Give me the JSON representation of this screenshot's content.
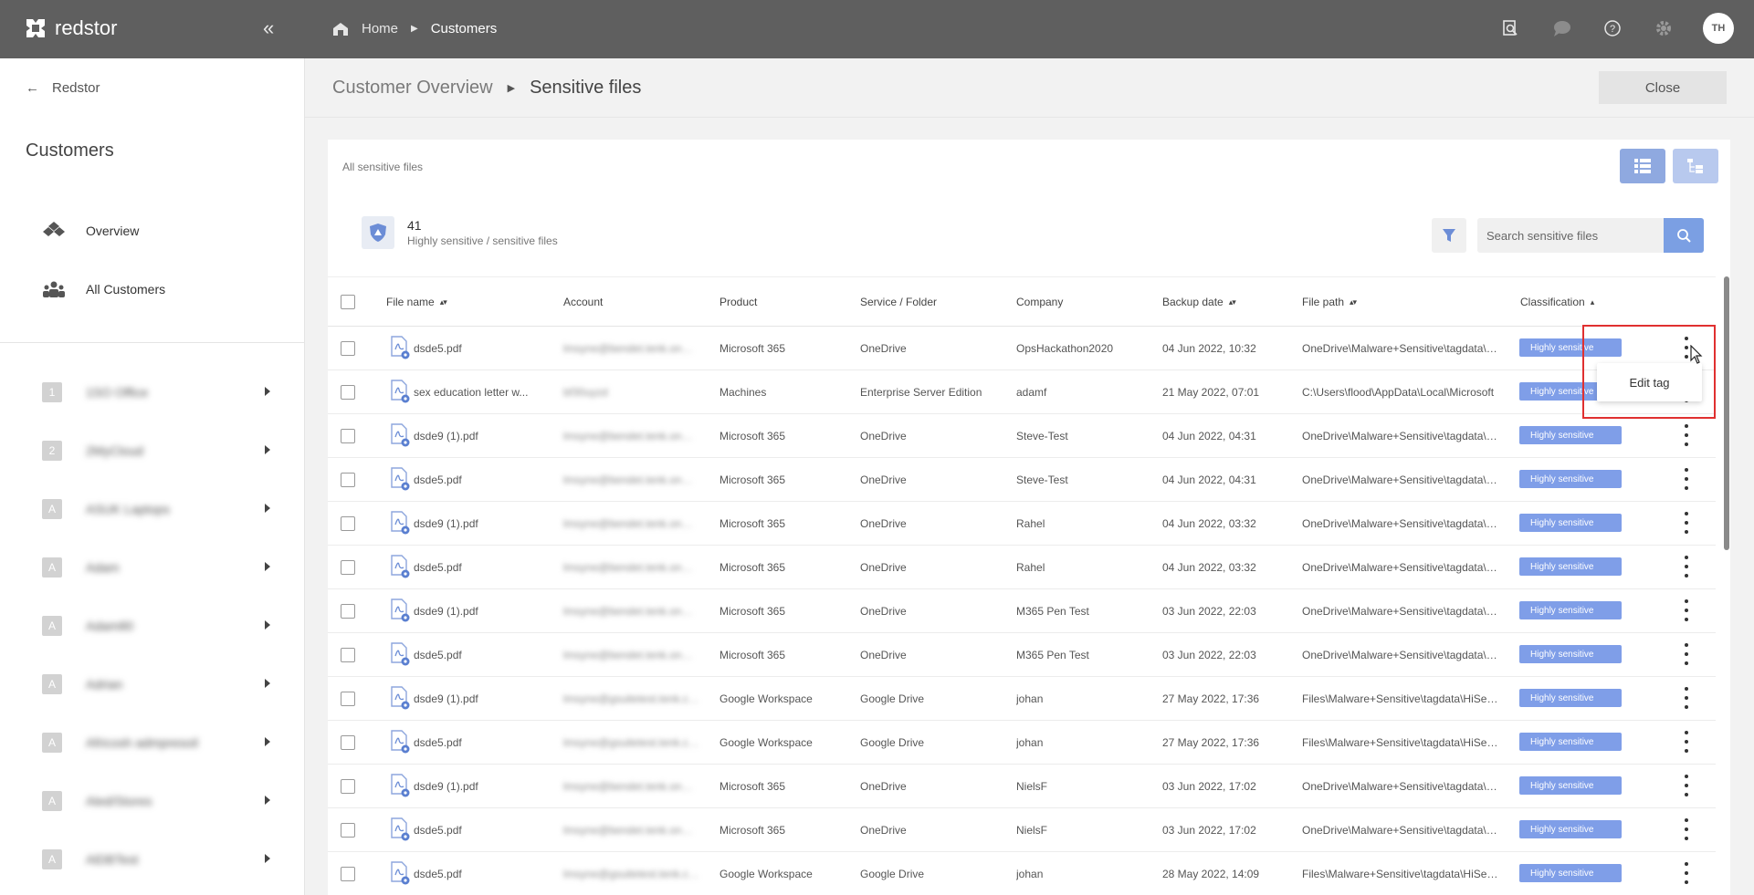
{
  "app": {
    "brand": "redstor",
    "user_initials": "TH"
  },
  "topnav": {
    "breadcrumbs": [
      "Home",
      "Customers"
    ],
    "icons": [
      "search-file-icon",
      "chat-icon",
      "help-icon",
      "gear-icon"
    ]
  },
  "sidebar": {
    "back_label": "Redstor",
    "title": "Customers",
    "nav": [
      {
        "label": "Overview",
        "icon": "overview-icon"
      },
      {
        "label": "All Customers",
        "icon": "people-icon"
      }
    ],
    "customers": [
      {
        "badge": "1",
        "name": "1SO Office"
      },
      {
        "badge": "2",
        "name": "2MyCloud"
      },
      {
        "badge": "A",
        "name": "ASUK Laptops"
      },
      {
        "badge": "A",
        "name": "Adam"
      },
      {
        "badge": "A",
        "name": "Adam80"
      },
      {
        "badge": "A",
        "name": "Adrian"
      },
      {
        "badge": "A",
        "name": "Africosh admpresoil"
      },
      {
        "badge": "A",
        "name": "Aled/Stores"
      },
      {
        "badge": "A",
        "name": "AlDBTest"
      }
    ]
  },
  "page": {
    "breadcrumb_parent": "Customer Overview",
    "breadcrumb_current": "Sensitive files",
    "close_label": "Close"
  },
  "card": {
    "label": "All sensitive files",
    "count": "41",
    "count_label": "Highly sensitive / sensitive files",
    "search_placeholder": "Search sensitive files"
  },
  "table": {
    "columns": [
      "File name",
      "Account",
      "Product",
      "Service / Folder",
      "Company",
      "Backup date",
      "File path",
      "Classification"
    ],
    "rows": [
      {
        "file": "dsde5.pdf",
        "account": "lmsyne@bendet.tenk.onmicrosoft.com",
        "product": "Microsoft 365",
        "service": "OneDrive",
        "company": "OpsHackathon2020",
        "date": "04 Jun 2022, 10:32",
        "path": "OneDrive\\Malware+Sensitive\\tagdata\\HiSens",
        "class": "Highly sensitive"
      },
      {
        "file": "sex education letter w...",
        "account": "bf30uyzd",
        "product": "Machines",
        "service": "Enterprise Server Edition",
        "company": "adamf",
        "date": "21 May 2022, 07:01",
        "path": "C:\\Users\\flood\\AppData\\Local\\Microsoft",
        "class": "Highly sensitive"
      },
      {
        "file": "dsde9 (1).pdf",
        "account": "lmsyne@bendet.tenk.onmicrosoft.com",
        "product": "Microsoft 365",
        "service": "OneDrive",
        "company": "Steve-Test",
        "date": "04 Jun 2022, 04:31",
        "path": "OneDrive\\Malware+Sensitive\\tagdata\\HiSens",
        "class": "Highly sensitive"
      },
      {
        "file": "dsde5.pdf",
        "account": "lmsyne@bendet.tenk.onmicrosoft.com",
        "product": "Microsoft 365",
        "service": "OneDrive",
        "company": "Steve-Test",
        "date": "04 Jun 2022, 04:31",
        "path": "OneDrive\\Malware+Sensitive\\tagdata\\HiSens",
        "class": "Highly sensitive"
      },
      {
        "file": "dsde9 (1).pdf",
        "account": "lmsyne@bendet.tenk.onmicrosoft.com",
        "product": "Microsoft 365",
        "service": "OneDrive",
        "company": "Rahel",
        "date": "04 Jun 2022, 03:32",
        "path": "OneDrive\\Malware+Sensitive\\tagdata\\HiSens",
        "class": "Highly sensitive"
      },
      {
        "file": "dsde5.pdf",
        "account": "lmsyne@bendet.tenk.onmicrosoft.com",
        "product": "Microsoft 365",
        "service": "OneDrive",
        "company": "Rahel",
        "date": "04 Jun 2022, 03:32",
        "path": "OneDrive\\Malware+Sensitive\\tagdata\\HiSens",
        "class": "Highly sensitive"
      },
      {
        "file": "dsde9 (1).pdf",
        "account": "lmsyne@bendet.tenk.onmicrosoft.com",
        "product": "Microsoft 365",
        "service": "OneDrive",
        "company": "M365 Pen Test",
        "date": "03 Jun 2022, 22:03",
        "path": "OneDrive\\Malware+Sensitive\\tagdata\\HiSens",
        "class": "Highly sensitive"
      },
      {
        "file": "dsde5.pdf",
        "account": "lmsyne@bendet.tenk.onmicrosoft.com",
        "product": "Microsoft 365",
        "service": "OneDrive",
        "company": "M365 Pen Test",
        "date": "03 Jun 2022, 22:03",
        "path": "OneDrive\\Malware+Sensitive\\tagdata\\HiSens",
        "class": "Highly sensitive"
      },
      {
        "file": "dsde9 (1).pdf",
        "account": "lmsyne@gsuitetest.tenk.com",
        "product": "Google Workspace",
        "service": "Google Drive",
        "company": "johan",
        "date": "27 May 2022, 17:36",
        "path": "Files\\Malware+Sensitive\\tagdata\\HiSens",
        "class": "Highly sensitive"
      },
      {
        "file": "dsde5.pdf",
        "account": "lmsyne@gsuitetest.tenk.com",
        "product": "Google Workspace",
        "service": "Google Drive",
        "company": "johan",
        "date": "27 May 2022, 17:36",
        "path": "Files\\Malware+Sensitive\\tagdata\\HiSens",
        "class": "Highly sensitive"
      },
      {
        "file": "dsde9 (1).pdf",
        "account": "lmsyne@bendet.tenk.onmicrosoft.com",
        "product": "Microsoft 365",
        "service": "OneDrive",
        "company": "NielsF",
        "date": "03 Jun 2022, 17:02",
        "path": "OneDrive\\Malware+Sensitive\\tagdata\\HiSens",
        "class": "Highly sensitive"
      },
      {
        "file": "dsde5.pdf",
        "account": "lmsyne@bendet.tenk.onmicrosoft.com",
        "product": "Microsoft 365",
        "service": "OneDrive",
        "company": "NielsF",
        "date": "03 Jun 2022, 17:02",
        "path": "OneDrive\\Malware+Sensitive\\tagdata\\HiSens",
        "class": "Highly sensitive"
      },
      {
        "file": "dsde5.pdf",
        "account": "lmsyne@gsuitetest.tenk.com",
        "product": "Google Workspace",
        "service": "Google Drive",
        "company": "johan",
        "date": "28 May 2022, 14:09",
        "path": "Files\\Malware+Sensitive\\tagdata\\HiSens",
        "class": "Highly sensitive"
      }
    ]
  },
  "context_menu": {
    "item": "Edit tag"
  },
  "colors": {
    "topbar": "#5f5f5f",
    "accent": "#7b9fe3",
    "tag": "#7f9ee8",
    "highlight": "#e03030"
  }
}
